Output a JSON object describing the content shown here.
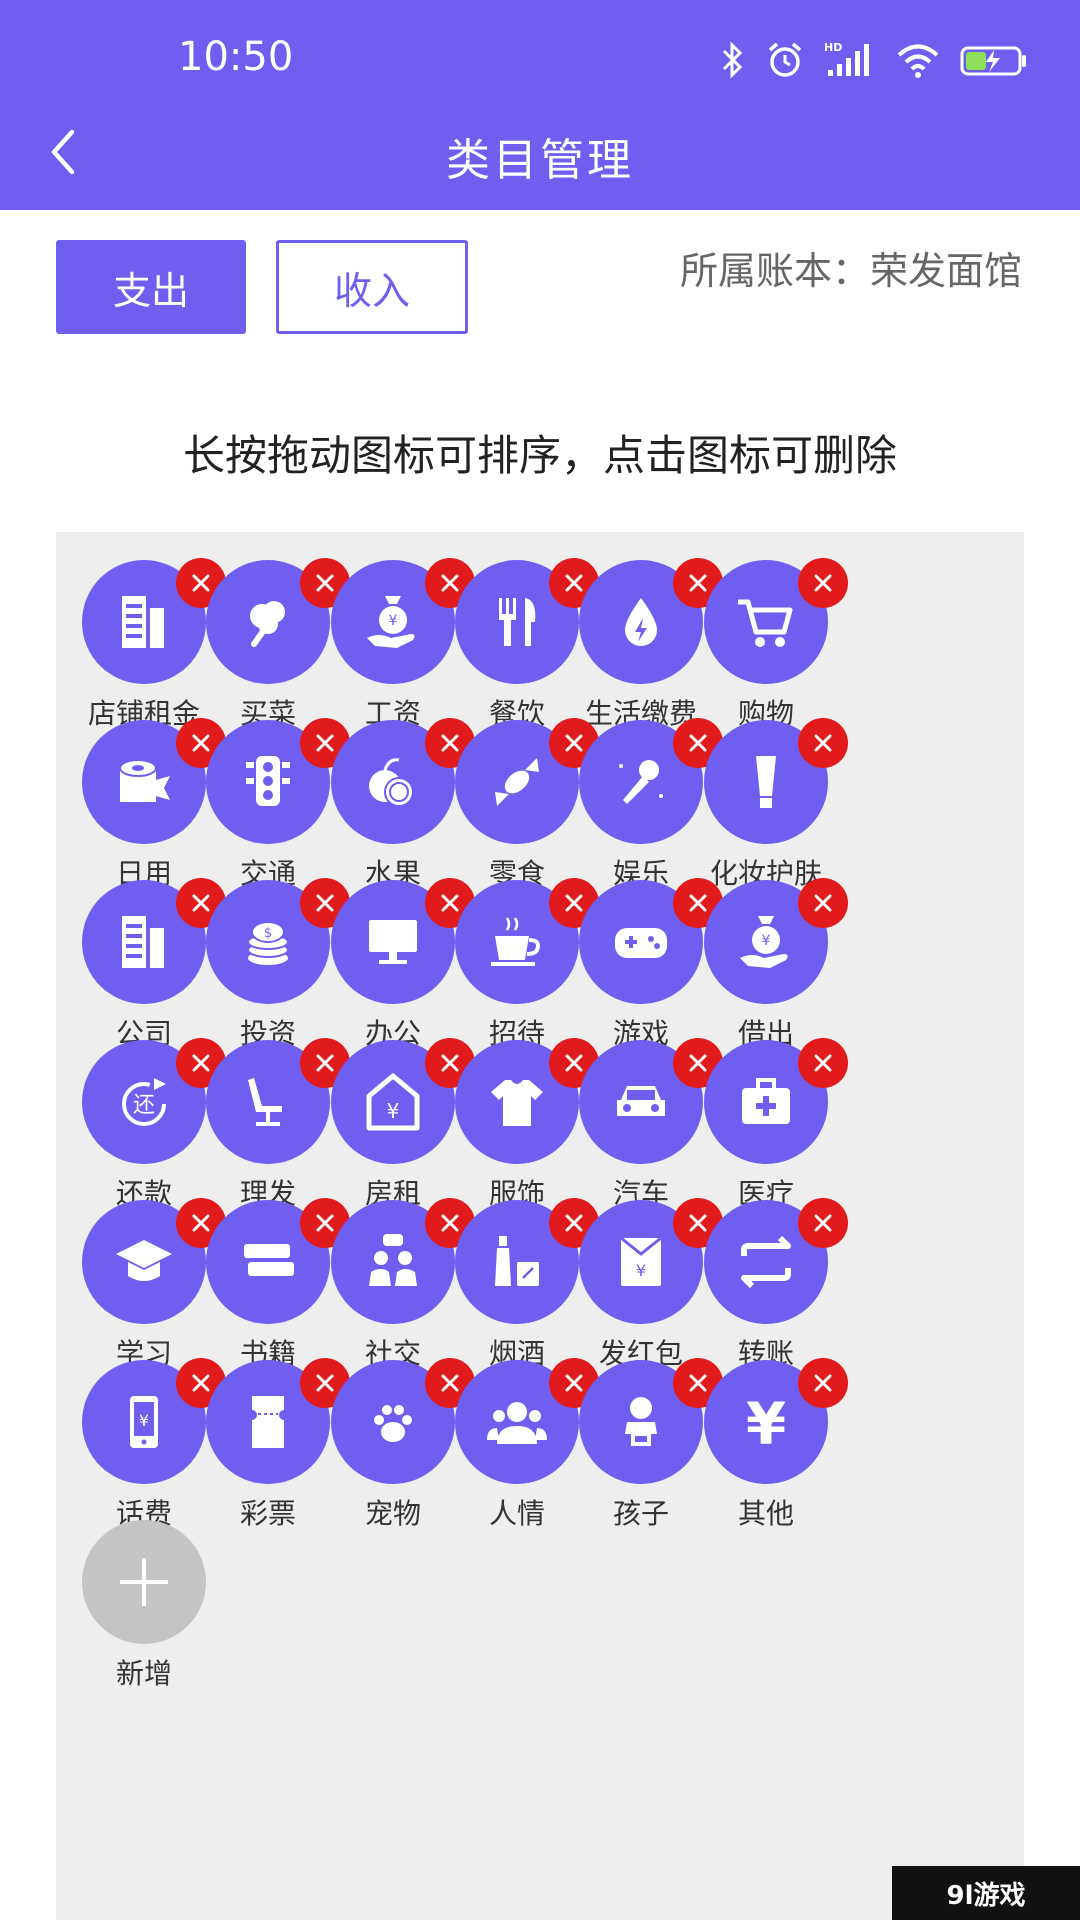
{
  "status_bar": {
    "time": "10:50"
  },
  "header": {
    "title": "类目管理"
  },
  "type_tabs": {
    "expense": "支出",
    "income": "收入"
  },
  "ledger": "所属账本：荣发面馆",
  "hint": "长按拖动图标可排序，点击图标可删除",
  "categories": [
    {
      "label": "店铺租金",
      "icon": "building-icon"
    },
    {
      "label": "买菜",
      "icon": "vegetable-icon"
    },
    {
      "label": "工资",
      "icon": "money-bag-icon"
    },
    {
      "label": "餐饮",
      "icon": "fork-spoon-icon"
    },
    {
      "label": "生活缴费",
      "icon": "water-drop-icon"
    },
    {
      "label": "购物",
      "icon": "cart-icon"
    },
    {
      "label": "日用",
      "icon": "tissue-roll-icon"
    },
    {
      "label": "交通",
      "icon": "traffic-light-icon"
    },
    {
      "label": "水果",
      "icon": "fruit-icon"
    },
    {
      "label": "零食",
      "icon": "candy-icon"
    },
    {
      "label": "娱乐",
      "icon": "microphone-icon"
    },
    {
      "label": "化妆护肤",
      "icon": "cosmetic-tube-icon"
    },
    {
      "label": "公司",
      "icon": "building-icon"
    },
    {
      "label": "投资",
      "icon": "coins-icon"
    },
    {
      "label": "办公",
      "icon": "monitor-icon"
    },
    {
      "label": "招待",
      "icon": "coffee-cup-icon"
    },
    {
      "label": "游戏",
      "icon": "gamepad-icon"
    },
    {
      "label": "借出",
      "icon": "money-bag-icon"
    },
    {
      "label": "还款",
      "icon": "repay-icon"
    },
    {
      "label": "理发",
      "icon": "barber-chair-icon"
    },
    {
      "label": "房租",
      "icon": "house-yen-icon"
    },
    {
      "label": "服饰",
      "icon": "tshirt-icon"
    },
    {
      "label": "汽车",
      "icon": "car-icon"
    },
    {
      "label": "医疗",
      "icon": "medical-kit-icon"
    },
    {
      "label": "学习",
      "icon": "graduation-cap-icon"
    },
    {
      "label": "书籍",
      "icon": "books-icon"
    },
    {
      "label": "社交",
      "icon": "people-chat-icon"
    },
    {
      "label": "烟酒",
      "icon": "bottle-icon"
    },
    {
      "label": "发红包",
      "icon": "red-envelope-icon"
    },
    {
      "label": "转账",
      "icon": "transfer-icon"
    },
    {
      "label": "话费",
      "icon": "phone-icon"
    },
    {
      "label": "彩票",
      "icon": "lottery-ticket-icon"
    },
    {
      "label": "宠物",
      "icon": "paw-icon"
    },
    {
      "label": "人情",
      "icon": "people-group-icon"
    },
    {
      "label": "孩子",
      "icon": "baby-icon"
    },
    {
      "label": "其他",
      "icon": "yen-icon"
    }
  ],
  "add_button": {
    "label": "新增",
    "icon": "plus-icon"
  },
  "watermark": "9l游戏",
  "colors": {
    "primary": "#6f5ef0",
    "delete": "#e11b1b",
    "panel": "#eeeeee",
    "add": "#c4c4c4"
  }
}
